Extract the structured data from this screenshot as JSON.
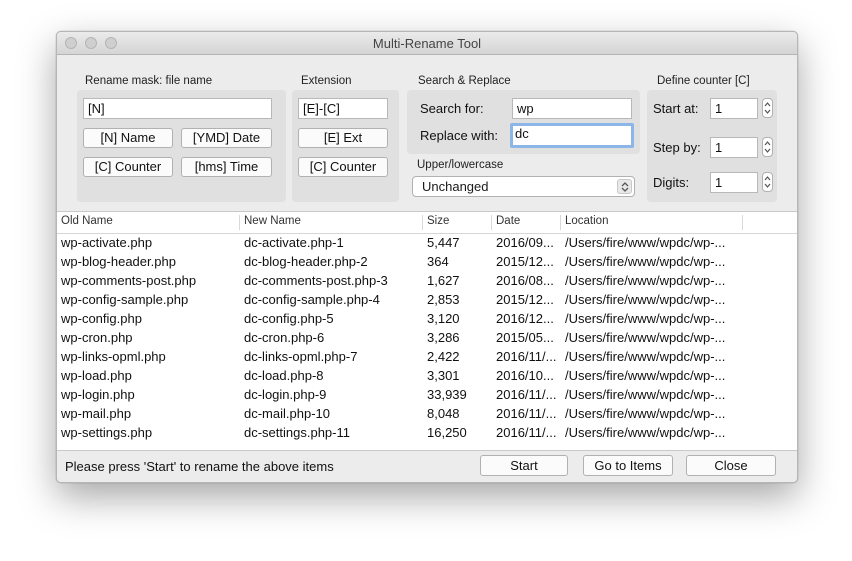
{
  "window": {
    "title": "Multi-Rename Tool"
  },
  "rename_mask": {
    "label": "Rename mask: file name",
    "value": "[N]",
    "buttons": [
      "[N] Name",
      "[YMD] Date",
      "[C] Counter",
      "[hms] Time"
    ]
  },
  "extension": {
    "label": "Extension",
    "value": "[E]-[C]",
    "buttons": [
      "[E] Ext",
      "[C] Counter"
    ]
  },
  "search_replace": {
    "label": "Search & Replace",
    "search_label": "Search for:",
    "search_value": "wp",
    "replace_label": "Replace with:",
    "replace_value": "dc"
  },
  "case": {
    "label": "Upper/lowercase",
    "selected": "Unchanged"
  },
  "counter": {
    "label": "Define counter [C]",
    "start_label": "Start at:",
    "start_value": "1",
    "step_label": "Step by:",
    "step_value": "1",
    "digits_label": "Digits:",
    "digits_value": "1"
  },
  "table": {
    "columns": [
      "Old Name",
      "New Name",
      "Size",
      "Date",
      "Location"
    ],
    "rows": [
      [
        "wp-activate.php",
        "dc-activate.php-1",
        "5,447",
        "2016/09...",
        "/Users/fire/www/wpdc/wp-..."
      ],
      [
        "wp-blog-header.php",
        "dc-blog-header.php-2",
        "364",
        "2015/12...",
        "/Users/fire/www/wpdc/wp-..."
      ],
      [
        "wp-comments-post.php",
        "dc-comments-post.php-3",
        "1,627",
        "2016/08...",
        "/Users/fire/www/wpdc/wp-..."
      ],
      [
        "wp-config-sample.php",
        "dc-config-sample.php-4",
        "2,853",
        "2015/12...",
        "/Users/fire/www/wpdc/wp-..."
      ],
      [
        "wp-config.php",
        "dc-config.php-5",
        "3,120",
        "2016/12...",
        "/Users/fire/www/wpdc/wp-..."
      ],
      [
        "wp-cron.php",
        "dc-cron.php-6",
        "3,286",
        "2015/05...",
        "/Users/fire/www/wpdc/wp-..."
      ],
      [
        "wp-links-opml.php",
        "dc-links-opml.php-7",
        "2,422",
        "2016/11/...",
        "/Users/fire/www/wpdc/wp-..."
      ],
      [
        "wp-load.php",
        "dc-load.php-8",
        "3,301",
        "2016/10...",
        "/Users/fire/www/wpdc/wp-..."
      ],
      [
        "wp-login.php",
        "dc-login.php-9",
        "33,939",
        "2016/11/...",
        "/Users/fire/www/wpdc/wp-..."
      ],
      [
        "wp-mail.php",
        "dc-mail.php-10",
        "8,048",
        "2016/11/...",
        "/Users/fire/www/wpdc/wp-..."
      ],
      [
        "wp-settings.php",
        "dc-settings.php-11",
        "16,250",
        "2016/11/...",
        "/Users/fire/www/wpdc/wp-..."
      ]
    ]
  },
  "footer": {
    "status": "Please press 'Start' to rename the above items",
    "start_label": "Start",
    "goto_label": "Go to Items",
    "close_label": "Close"
  },
  "icons": {
    "traffic_lights": [
      "close-icon",
      "minimize-icon",
      "zoom-icon"
    ],
    "stepper": "stepper-arrows-icon",
    "select": "select-arrows-icon"
  },
  "colors": {
    "focus_ring": "#8cb5e8",
    "window_bg": "#ececec",
    "panel_bg": "#e0e0e0"
  }
}
